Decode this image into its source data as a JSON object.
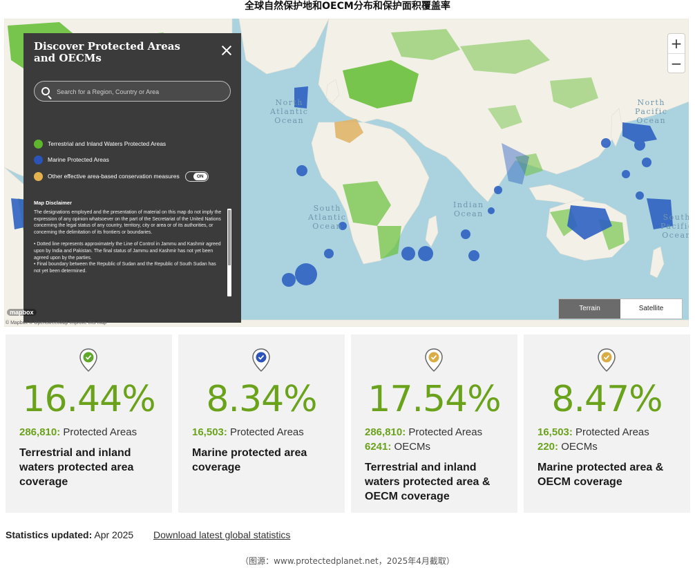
{
  "page_title": "全球自然保护地和OECM分布和保护面积覆盖率",
  "map": {
    "ocean_labels": {
      "north_atlantic": "North\nAtlantic\nOcean",
      "south_atlantic": "South\nAtlantic\nOcean",
      "indian": "Indian\nOcean",
      "north_pacific": "North\nPacific\nOcean",
      "south_pacific": "South\nPacific\nOcean"
    },
    "zoom_in": "+",
    "zoom_out": "−",
    "mapbox_logo": "mapbox",
    "attribution": "© Mapbox © OpenStreetMap  Improve this map",
    "layers": {
      "terrain": "Terrain",
      "satellite": "Satellite",
      "active": "Terrain"
    },
    "colors": {
      "ocean": "#aad3df",
      "land": "#f3f0e8",
      "terrestrial": "#6ac03c",
      "marine": "#2f62c2",
      "oecm": "#e0b56a"
    }
  },
  "panel": {
    "title": "Discover Protected Areas and OECMs",
    "close_icon": "close-icon",
    "search_placeholder": "Search for a Region, Country or Area",
    "legend": [
      {
        "label": "Terrestrial and Inland Waters Protected Areas",
        "color": "#5fb52b"
      },
      {
        "label": "Marine Protected Areas",
        "color": "#2c54b8"
      },
      {
        "label": "Other effective area-based conservation measures",
        "color": "#e3b24f"
      }
    ],
    "oecm_toggle": "ON",
    "disclaimer_title": "Map Disclaimer",
    "disclaimer_p1": "The designations employed and the presentation of material on this map do not imply the expression of any opinion whatsoever on the part of the Secretariat of the United Nations concerning the legal status of any country, territory, city or area or of its authorities, or concerning the delimitation of its frontiers or boundaries.",
    "disclaimer_p2": "• Dotted line represents approximately the Line of Control in Jammu and Kashmir agreed upon by India and Pakistan. The final status of Jammu and Kashmir has not yet been agreed upon by the parties.\n• Final boundary between the Republic of Sudan and the Republic of South Sudan has not yet been determined."
  },
  "cards": [
    {
      "value": "16.44%",
      "lines": [
        {
          "num": "286,810:",
          "text": " Protected Areas"
        }
      ],
      "desc": "Terrestrial and inland waters protected area coverage",
      "pin_color": "#5fa82a",
      "icon": "map-pin-check-icon"
    },
    {
      "value": "8.34%",
      "lines": [
        {
          "num": "16,503:",
          "text": " Protected Areas"
        }
      ],
      "desc": "Marine protected area coverage",
      "pin_color": "#2c54b8",
      "icon": "map-pin-check-icon"
    },
    {
      "value": "17.54%",
      "lines": [
        {
          "num": "286,810:",
          "text": " Protected Areas"
        },
        {
          "num": "6241:",
          "text": " OECMs"
        }
      ],
      "desc": "Terrestrial and inland waters protected area & OECM coverage",
      "pin_color": "#d9ad45",
      "icon": "map-pin-check-icon"
    },
    {
      "value": "8.47%",
      "lines": [
        {
          "num": "16,503:",
          "text": " Protected Areas"
        },
        {
          "num": "220:",
          "text": " OECMs"
        }
      ],
      "desc": "Marine protected area & OECM coverage",
      "pin_color": "#d9ad45",
      "icon": "map-pin-check-icon"
    }
  ],
  "footer": {
    "stats_label": "Statistics updated:",
    "stats_date": " Apr 2025",
    "download_link": "Download latest global statistics"
  },
  "source_caption": "（图源：www.protectedplanet.net，2025年4月截取）"
}
